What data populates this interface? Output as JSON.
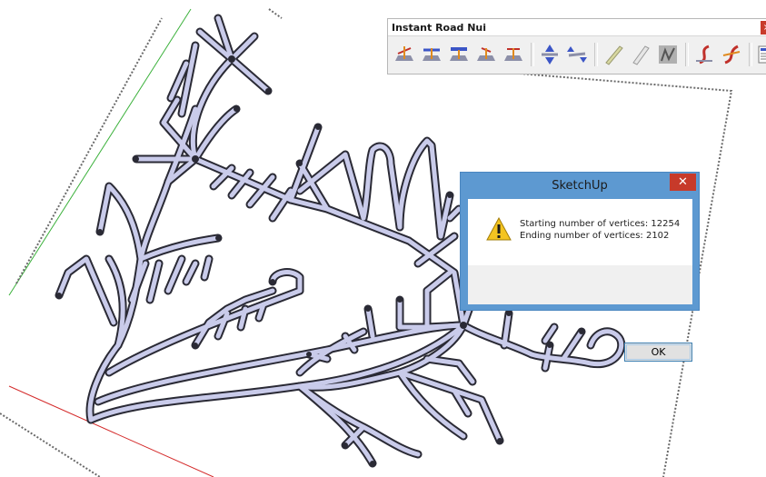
{
  "toolbar": {
    "title": "Instant Road Nui",
    "close_glyph": "×",
    "tools": [
      {
        "name": "road-tool-1-icon"
      },
      {
        "name": "road-tool-2-icon"
      },
      {
        "name": "road-tool-3-icon"
      },
      {
        "name": "road-tool-4-icon"
      },
      {
        "name": "road-tool-5-icon"
      },
      {
        "name": "road-tool-6-icon"
      },
      {
        "name": "road-tool-7-icon"
      },
      {
        "name": "road-tool-8-icon"
      },
      {
        "name": "road-tool-9-icon"
      },
      {
        "name": "road-tool-10-icon"
      },
      {
        "name": "road-tool-11-icon"
      },
      {
        "name": "road-tool-12-icon"
      },
      {
        "name": "road-tool-13-icon"
      }
    ]
  },
  "dialog": {
    "title": "SketchUp",
    "close_glyph": "✕",
    "icon": "warning-icon",
    "line1": "Starting number of vertices: 12254",
    "line2": "Ending number of vertices: 2102",
    "ok_label": "OK"
  },
  "colors": {
    "road_fill": "#c9cbea",
    "road_outline": "#2a2a35",
    "dialog_frame": "#5d99d1",
    "close_red": "#c73a2a",
    "axis_green": "#3bb13b",
    "axis_red": "#d42a2a"
  }
}
